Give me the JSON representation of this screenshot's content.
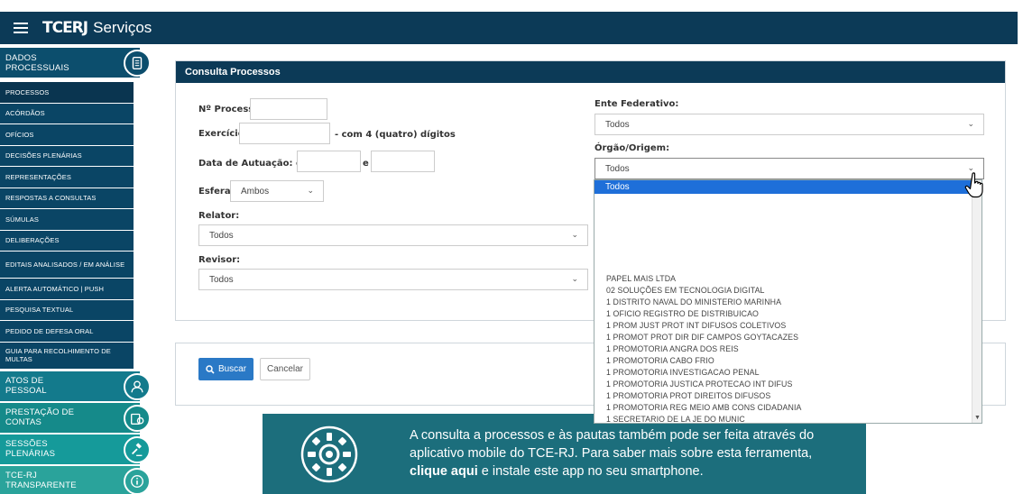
{
  "header": {
    "logo_mark": "TCERJ",
    "logo_text": "Serviços"
  },
  "sidebar": {
    "sections": [
      {
        "label": "DADOS PROCESSUAIS",
        "color": "#0c4e6d",
        "icon": "document-icon"
      },
      {
        "label": "ATOS DE PESSOAL",
        "color": "#137a8c",
        "icon": "person-icon"
      },
      {
        "label": "PRESTAÇÃO DE CONTAS",
        "color": "#158a8a",
        "icon": "money-icon"
      },
      {
        "label": "SESSÕES PLENÁRIAS",
        "color": "#159a9a",
        "icon": "gavel-icon"
      },
      {
        "label": "TCE-RJ TRANSPARENTE",
        "color": "#2aa39b",
        "icon": "info-icon"
      }
    ],
    "items": [
      "PROCESSOS",
      "ACÓRDÃOS",
      "OFÍCIOS",
      "DECISÕES PLENÁRIAS",
      "REPRESENTAÇÕES",
      "RESPOSTAS A CONSULTAS",
      "SÚMULAS",
      "DELIBERAÇÕES",
      "EDITAIS ANALISADOS / EM ANÁLISE",
      "ALERTA AUTOMÁTICO | PUSH",
      "PESQUISA TEXTUAL",
      "PEDIDO DE DEFESA ORAL",
      "GUIA PARA RECOLHIMENTO DE MULTAS"
    ]
  },
  "form": {
    "title": "Consulta Processos",
    "processo_label": "Nº Processo:",
    "exercicio_label": "Exercício:",
    "exercicio_note": "- com 4 (quatro) dígitos",
    "data_label": "Data de Autuação: entre",
    "data_sep": "e",
    "esfera_label": "Esfera:",
    "esfera_value": "Ambos",
    "relator_label": "Relator:",
    "relator_value": "Todos",
    "revisor_label": "Revisor:",
    "revisor_value": "Todos",
    "ente_label": "Ente Federativo:",
    "ente_value": "Todos",
    "orgao_label": "Órgão/Origem:",
    "orgao_value": "Todos",
    "buscar_label": "Buscar",
    "cancelar_label": "Cancelar"
  },
  "dropdown": {
    "selected": "Todos",
    "options": [
      "PAPEL MAIS LTDA",
      "02 SOLUÇÕES EM TECNOLOGIA DIGITAL",
      "1 DISTRITO NAVAL DO MINISTERIO MARINHA",
      "1 OFICIO REGISTRO DE DISTRIBUICAO",
      "1 PROM JUST PROT INT DIFUSOS COLETIVOS",
      "1 PROMOT PROT DIR DIF CAMPOS GOYTACAZES",
      "1 PROMOTORIA ANGRA DOS REIS",
      "1 PROMOTORIA CABO FRIO",
      "1 PROMOTORIA INVESTIGACAO PENAL",
      "1 PROMOTORIA JUSTICA PROTECAO INT DIFUS",
      "1 PROMOTORIA PROT DIREITOS DIFUSOS",
      "1 PROMOTORIA REG MEIO AMB CONS CIDADANIA",
      "1 SECRETARIO DE LA JE DO MUNIC"
    ]
  },
  "banner": {
    "line1": "A consulta a processos e às pautas também pode ser feita através do",
    "line2": "aplicativo mobile do TCE-RJ. Para saber mais sobre esta ferramenta,",
    "link": "clique aqui",
    "line3": " e instale este app no seu smartphone."
  }
}
